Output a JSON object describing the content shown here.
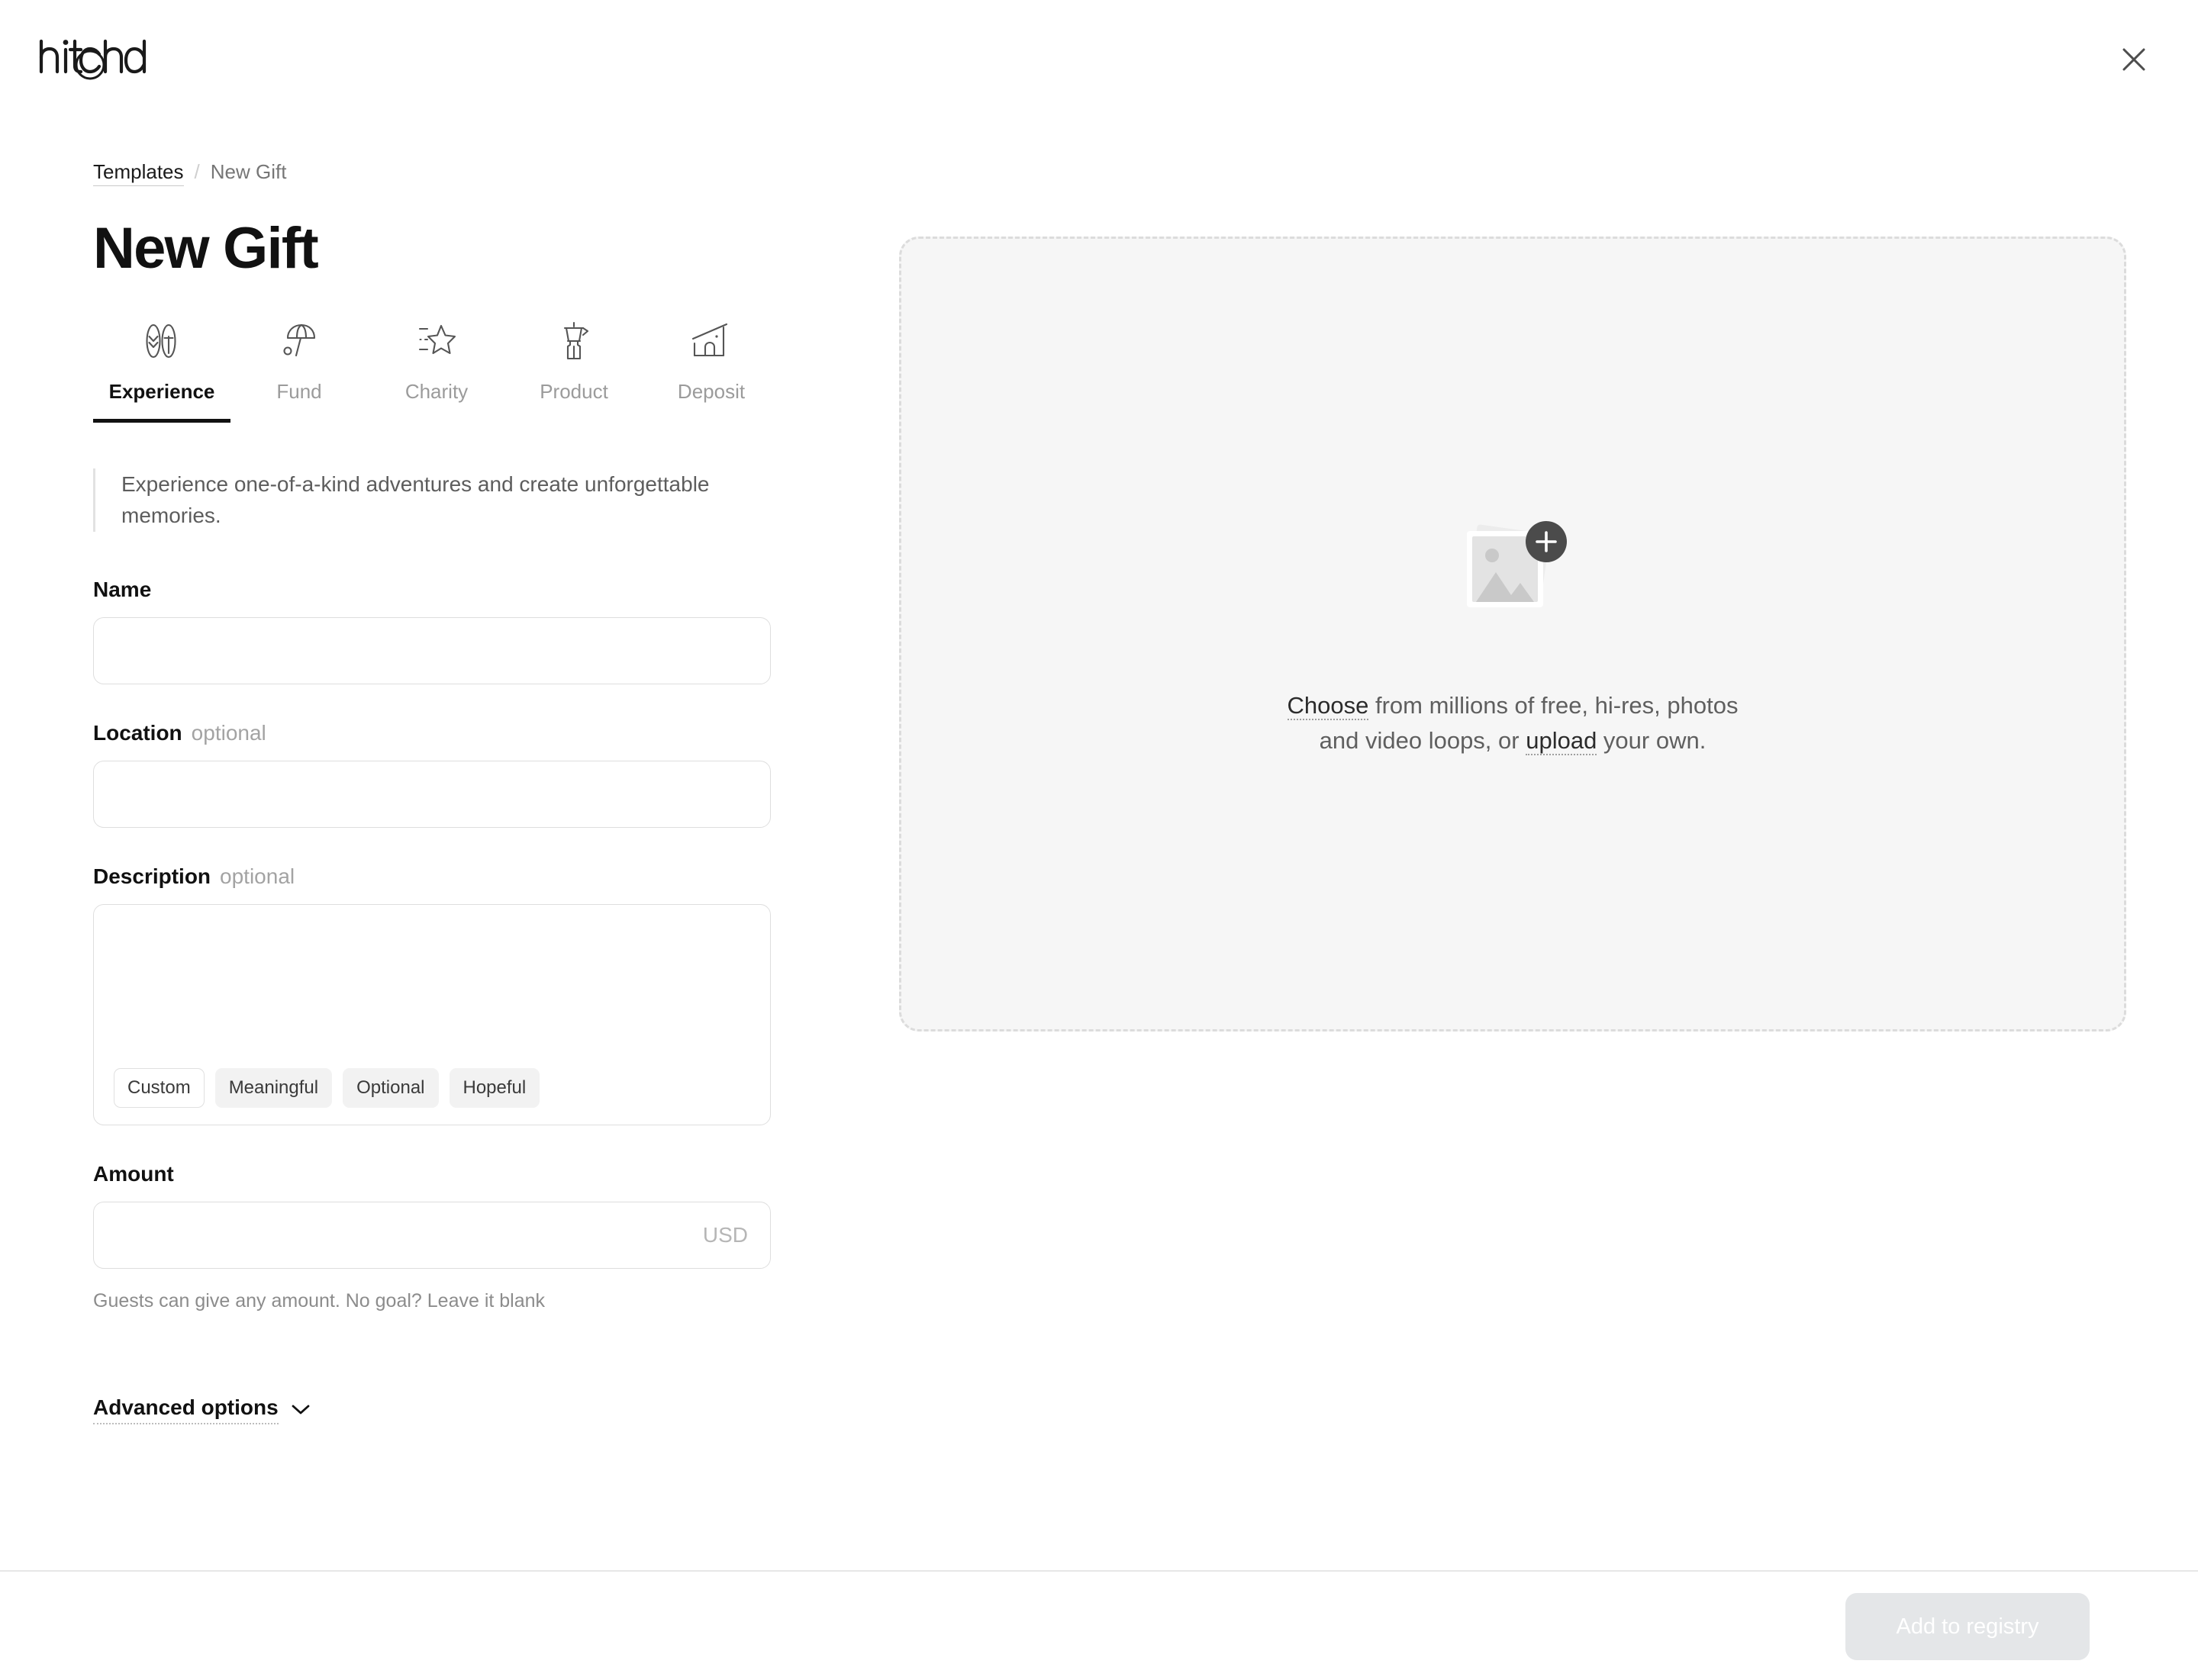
{
  "app": {
    "logo_text": "hitchd"
  },
  "topbar": {
    "close_label": "Close"
  },
  "breadcrumb": {
    "parent": "Templates",
    "separator": "/",
    "current": "New Gift"
  },
  "page": {
    "title": "New Gift"
  },
  "tabs": [
    {
      "label": "Experience",
      "icon": "surfboards-icon",
      "active": true
    },
    {
      "label": "Fund",
      "icon": "beach-umbrella-icon",
      "active": false
    },
    {
      "label": "Charity",
      "icon": "shooting-star-icon",
      "active": false
    },
    {
      "label": "Product",
      "icon": "moka-pot-icon",
      "active": false
    },
    {
      "label": "Deposit",
      "icon": "house-icon",
      "active": false
    }
  ],
  "blurb": {
    "text": "Experience one-of-a-kind adventures and create unforgettable memories."
  },
  "form": {
    "name": {
      "label": "Name",
      "value": "",
      "placeholder": ""
    },
    "location": {
      "label": "Location",
      "optional": "optional",
      "value": "",
      "placeholder": ""
    },
    "description": {
      "label": "Description",
      "optional": "optional",
      "value": "",
      "placeholder": "",
      "chips": [
        {
          "label": "Custom",
          "selected": true
        },
        {
          "label": "Meaningful",
          "selected": false
        },
        {
          "label": "Optional",
          "selected": false
        },
        {
          "label": "Hopeful",
          "selected": false
        }
      ]
    },
    "amount": {
      "label": "Amount",
      "value": "",
      "placeholder": "",
      "currency": "USD",
      "hint": "Guests can give any amount. No goal? Leave it blank"
    },
    "advanced": {
      "label": "Advanced options",
      "chevron": "chevron-down-icon"
    }
  },
  "media": {
    "icon": "image-placeholder-icon",
    "add_badge": "plus-icon",
    "line1_link": "Choose",
    "line1_rest": " from millions of free, hi-res, photos",
    "line2_pre": "and video loops, or ",
    "line2_link": "upload",
    "line2_rest": " your own."
  },
  "footer": {
    "submit_label": "Add to registry",
    "submit_disabled": true
  },
  "colors": {
    "text_primary": "#111111",
    "text_muted": "#8c8c8c",
    "border": "#dedede",
    "dropzone_bg": "#f6f6f6",
    "chip_bg": "#f2f2f2",
    "button_disabled_bg": "#e4e6e8"
  }
}
